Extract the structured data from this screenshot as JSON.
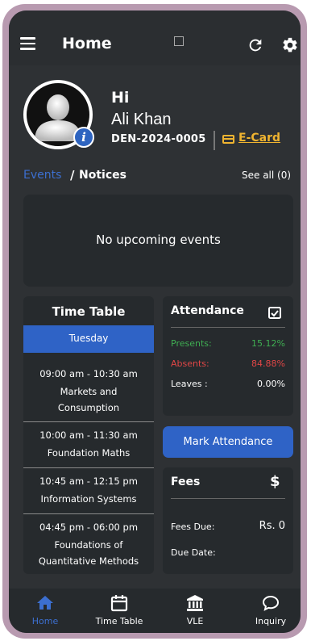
{
  "header": {
    "title": "Home"
  },
  "profile": {
    "greeting": "Hi",
    "name": "Ali Khan",
    "student_id": "DEN-2024-0005",
    "ecard_label": "E-Card"
  },
  "tabs": {
    "events": "Events",
    "separator": "/",
    "notices": "Notices",
    "see_all": "See all (0)"
  },
  "events": {
    "empty_message": "No upcoming events"
  },
  "timetable": {
    "title": "Time Table",
    "day": "Tuesday",
    "slots": [
      {
        "time": "09:00 am - 10:30 am",
        "course_line1": "Markets and",
        "course_line2": "Consumption"
      },
      {
        "time": "10:00 am - 11:30 am",
        "course_line1": "Foundation Maths",
        "course_line2": ""
      },
      {
        "time": "10:45 am - 12:15 pm",
        "course_line1": "Information Systems",
        "course_line2": ""
      },
      {
        "time": "04:45 pm - 06:00 pm",
        "course_line1": "Foundations of",
        "course_line2": "Quantitative Methods"
      }
    ]
  },
  "attendance": {
    "title": "Attendance",
    "rows": [
      {
        "label": "Presents:",
        "value": "15.12%",
        "color": "#3fae52"
      },
      {
        "label": "Absents:",
        "value": "84.88%",
        "color": "#e04646"
      },
      {
        "label": "Leaves :",
        "value": "0.00%",
        "color": "#ffffff"
      }
    ],
    "mark_button": "Mark Attendance"
  },
  "fees": {
    "title": "Fees",
    "fees_due_label": "Fees Due:",
    "fees_due_value": "Rs. 0",
    "due_date_label": "Due Date:",
    "due_date_value": ""
  },
  "bottom_nav": [
    {
      "label": "Home",
      "icon": "home-icon",
      "active": true
    },
    {
      "label": "Time Table",
      "icon": "calendar-icon",
      "active": false
    },
    {
      "label": "VLE",
      "icon": "bank-icon",
      "active": false
    },
    {
      "label": "Inquiry",
      "icon": "chat-icon",
      "active": false
    }
  ],
  "colors": {
    "accent": "#2f63c6",
    "link": "#3c6fd0",
    "ecard": "#f0b430",
    "background": "#2e3134",
    "card": "#262a2d"
  }
}
